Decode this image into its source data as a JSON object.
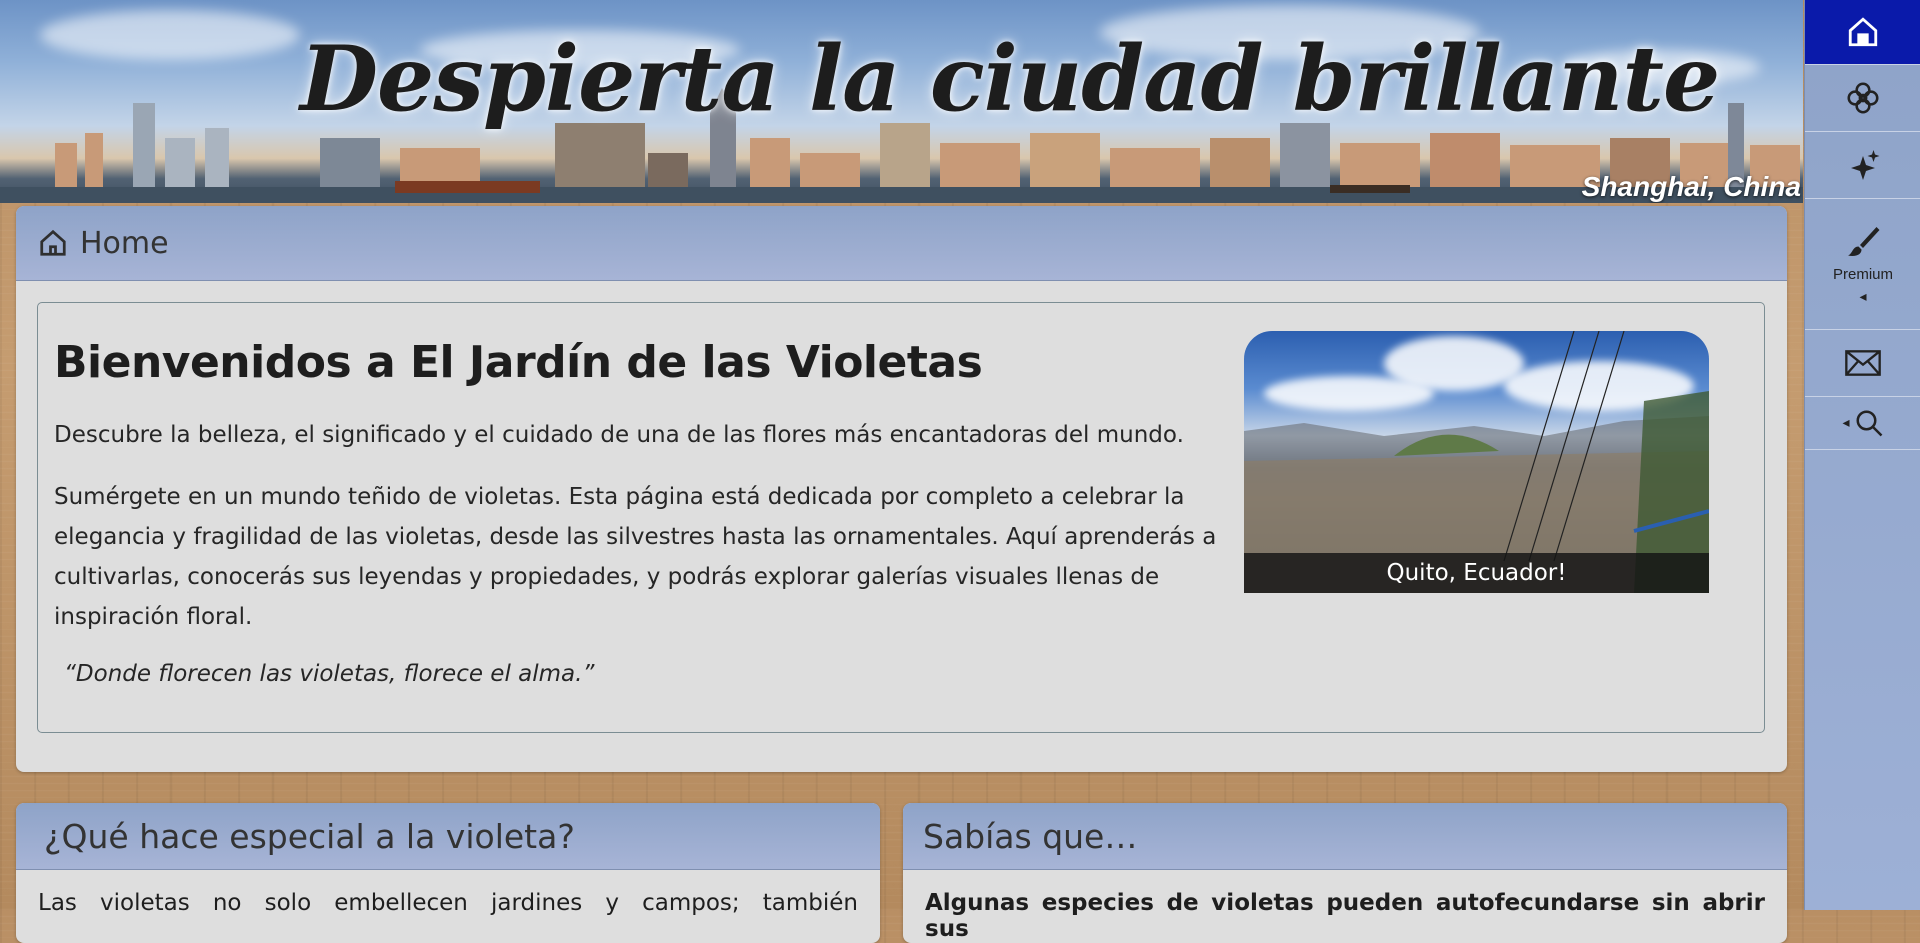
{
  "banner": {
    "title": "Despierta la ciudad brillante",
    "caption": "Shanghai, China"
  },
  "sidebar": {
    "items": [
      {
        "icon": "home-icon",
        "active": true
      },
      {
        "icon": "flower-icon"
      },
      {
        "icon": "sparkles-icon"
      },
      {
        "icon": "brush-icon",
        "label": "Premium",
        "caret": "◂"
      },
      {
        "icon": "mail-icon"
      },
      {
        "icon": "search-icon",
        "caret": "◂"
      }
    ]
  },
  "home": {
    "header_label": "Home",
    "title": "Bienvenidos a El Jardín de las Violetas",
    "lead": "Descubre la belleza, el significado y el cuidado de una de las flores más encantadoras del mundo.",
    "body": "Sumérgete en un mundo teñido de violetas. Esta página está dedicada por completo a celebrar la elegancia y fragilidad de las violetas, desde las silvestres hasta las ornamentales. Aquí aprenderás a cultivarlas, conocerás sus leyendas y propiedades, y podrás explorar galerías visuales llenas de inspiración floral.",
    "quote": "“Donde florecen las violetas, florece el alma.”",
    "photo_caption": "Quito, Ecuador!"
  },
  "special": {
    "title": "¿Qué hace especial a la violeta?",
    "body": "Las violetas no solo embellecen jardines y campos; también"
  },
  "facts": {
    "title": "Sabías que…",
    "body": "Algunas especies de violetas pueden autofecundarse sin abrir sus"
  },
  "colors": {
    "sidebar_active": "#0a1aaa",
    "panel_header": "#8ea3c8",
    "panel_bg": "#dedede"
  }
}
